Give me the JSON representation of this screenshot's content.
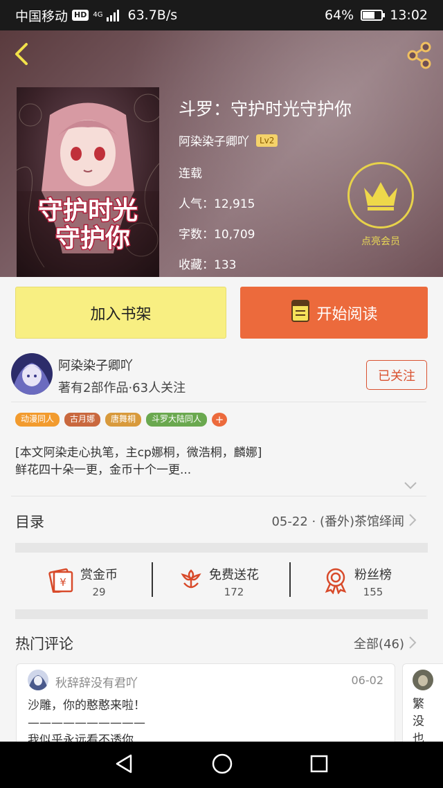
{
  "status_bar": {
    "carrier": "中国移动",
    "hd_badge": "HD",
    "network_type": "4G",
    "net_speed": "63.7B/s",
    "battery_level": 0.64,
    "battery_percent": "64%",
    "time": "13:02"
  },
  "book": {
    "title": "斗罗：守护时光守护你",
    "author": "阿染染子卿吖",
    "author_level": "Lv2",
    "status": "连载",
    "popularity_label": "人气：",
    "popularity": "12,915",
    "word_count_label": "字数：",
    "word_count": "10,709",
    "favorites_label": "收藏：",
    "favorites": "133",
    "cover_text_line1": "守护时光",
    "cover_text_line2": "守护你"
  },
  "vip": {
    "label": "点亮会员"
  },
  "actions": {
    "add_to_shelf": "加入书架",
    "start_reading": "开始阅读"
  },
  "author_card": {
    "name": "阿染染子卿吖",
    "stats": "著有2部作品·63人关注",
    "follow_state": "已关注"
  },
  "tags": [
    {
      "label": "动漫同人",
      "color": "#f29b2e"
    },
    {
      "label": "古月娜",
      "color": "#c9683e"
    },
    {
      "label": "唐舞桐",
      "color": "#d89a3c"
    },
    {
      "label": "斗罗大陆同人",
      "color": "#6aa84f"
    }
  ],
  "tag_more": "+",
  "intro": {
    "line1": "[本文阿染走心执笔，主cp娜桐，微浩桐，麟娜]",
    "line2": "鲜花四十朵一更，金币十个一更..."
  },
  "catalog": {
    "label": "目录",
    "latest": "05-22 · (番外)茶馆绎闻"
  },
  "stats": {
    "coins_label": "赏金币",
    "coins": "29",
    "flowers_label": "免费送花",
    "flowers": "172",
    "fans_label": "粉丝榜",
    "fans": "155"
  },
  "comments": {
    "section_label": "热门评论",
    "all_label": "全部(46)",
    "items": [
      {
        "user": "秋辞辞没有君吖",
        "date": "06-02",
        "line1": "沙雕，你的憨憨来啦！",
        "line2": "——————————",
        "line3": "我似乎永远看不透你"
      }
    ],
    "peek": {
      "line1": "繁",
      "line2": "没",
      "line3": "也"
    }
  },
  "colors": {
    "accent_orange": "#ec6a3c",
    "shelf_yellow": "#f8ef82",
    "follow_red": "#d9512f",
    "vip_gold": "#e7d24a"
  },
  "icons": {
    "back": "back-arrow-icon",
    "share": "share-icon",
    "crown": "crown-icon",
    "book": "book-icon",
    "coin": "red-envelope-icon",
    "flower": "flower-icon",
    "medal": "medal-icon"
  }
}
